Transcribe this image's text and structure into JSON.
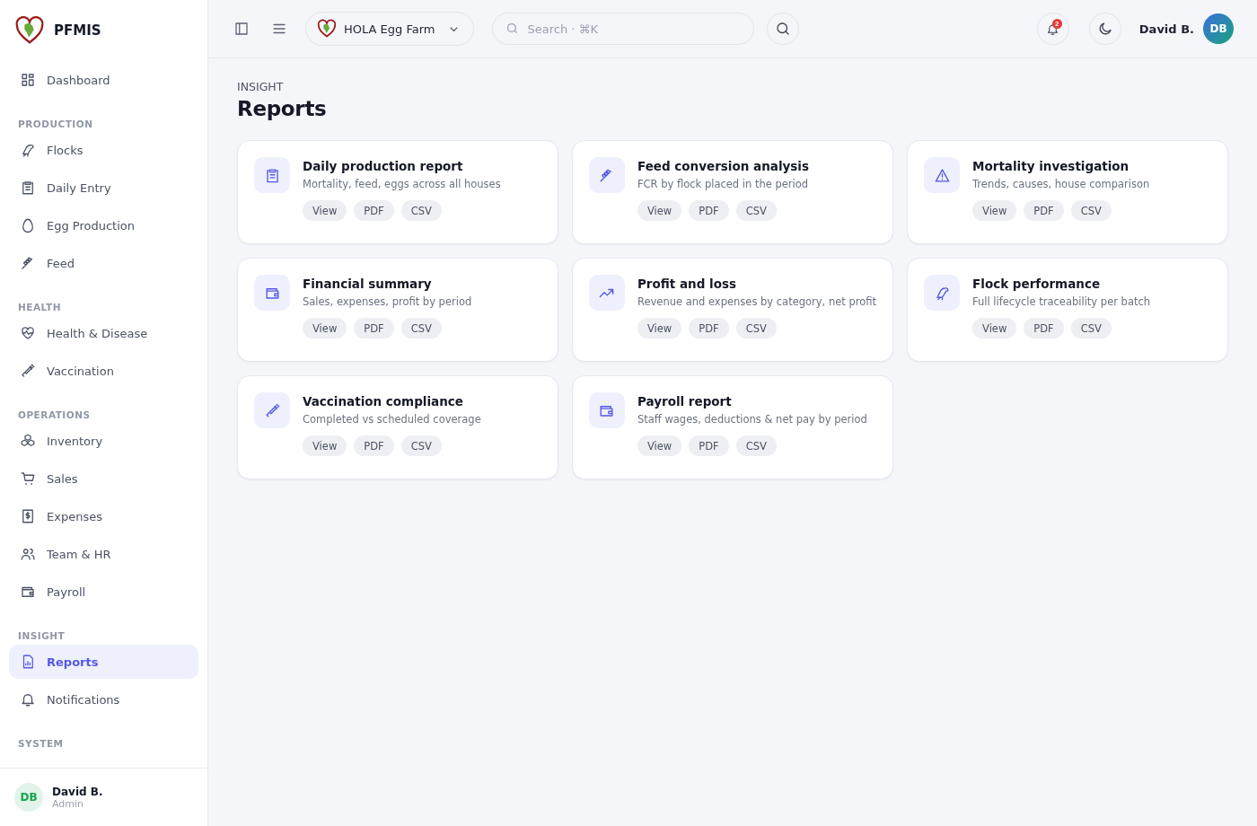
{
  "app": {
    "name": "PFMIS"
  },
  "sidebar": {
    "sections": [
      {
        "items": [
          {
            "label": "Dashboard",
            "selected": false
          }
        ]
      },
      {
        "label": "PRODUCTION",
        "items": [
          {
            "label": "Flocks",
            "selected": false
          },
          {
            "label": "Daily Entry",
            "selected": false
          },
          {
            "label": "Egg Production",
            "selected": false
          },
          {
            "label": "Feed",
            "selected": false
          }
        ]
      },
      {
        "label": "HEALTH",
        "items": [
          {
            "label": "Health & Disease",
            "selected": false
          },
          {
            "label": "Vaccination",
            "selected": false
          }
        ]
      },
      {
        "label": "OPERATIONS",
        "items": [
          {
            "label": "Inventory",
            "selected": false
          },
          {
            "label": "Sales",
            "selected": false
          },
          {
            "label": "Expenses",
            "selected": false
          },
          {
            "label": "Team & HR",
            "selected": false
          },
          {
            "label": "Payroll",
            "selected": false
          }
        ]
      },
      {
        "label": "INSIGHT",
        "items": [
          {
            "label": "Reports",
            "selected": true
          },
          {
            "label": "Notifications",
            "selected": false
          }
        ]
      },
      {
        "label": "SYSTEM"
      }
    ],
    "user": {
      "initials": "DB",
      "name": "David B.",
      "role": "Admin"
    }
  },
  "header": {
    "farm": "HOLA Egg Farm",
    "search": {
      "placeholder": "Search · ⌘K"
    },
    "notification_count": "2",
    "user": {
      "name": "David B.",
      "initials": "DB"
    }
  },
  "page": {
    "eyebrow": "INSIGHT",
    "title": "Reports"
  },
  "reports": [
    {
      "title": "Daily production report",
      "description": "Mortality, feed, eggs across all houses",
      "actions": [
        "View",
        "PDF",
        "CSV"
      ]
    },
    {
      "title": "Feed conversion analysis",
      "description": "FCR by flock placed in the period",
      "actions": [
        "View",
        "PDF",
        "CSV"
      ]
    },
    {
      "title": "Mortality investigation",
      "description": "Trends, causes, house comparison",
      "actions": [
        "View",
        "PDF",
        "CSV"
      ]
    },
    {
      "title": "Financial summary",
      "description": "Sales, expenses, profit by period",
      "actions": [
        "View",
        "PDF",
        "CSV"
      ]
    },
    {
      "title": "Profit and loss",
      "description": "Revenue and expenses by category, net profit",
      "actions": [
        "View",
        "PDF",
        "CSV"
      ]
    },
    {
      "title": "Flock performance",
      "description": "Full lifecycle traceability per batch",
      "actions": [
        "View",
        "PDF",
        "CSV"
      ]
    },
    {
      "title": "Vaccination compliance",
      "description": "Completed vs scheduled coverage",
      "actions": [
        "View",
        "PDF",
        "CSV"
      ]
    },
    {
      "title": "Payroll report",
      "description": "Staff wages, deductions & net pay by period",
      "actions": [
        "View",
        "PDF",
        "CSV"
      ]
    }
  ]
}
